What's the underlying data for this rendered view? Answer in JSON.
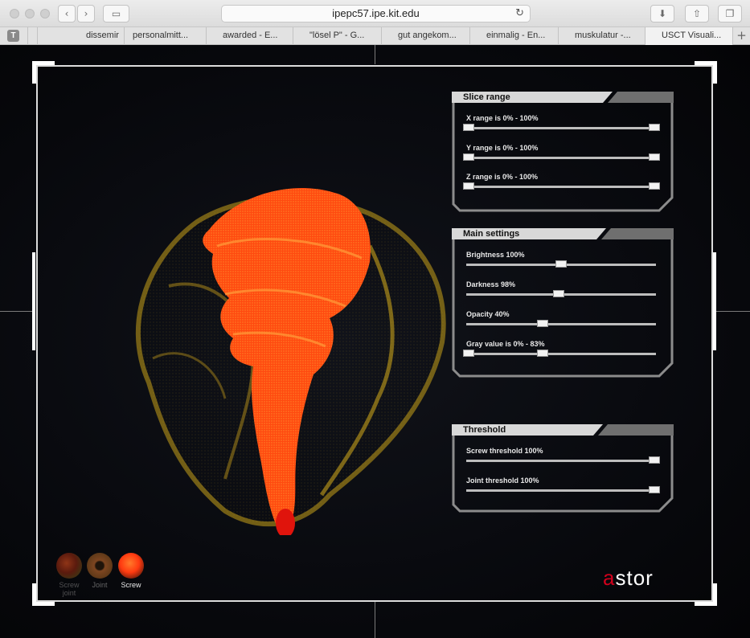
{
  "browser": {
    "url": "ipepc57.ipe.kit.edu",
    "tabs": [
      {
        "label": "dissemir"
      },
      {
        "label": "personalmitt..."
      },
      {
        "label": "awarded - E..."
      },
      {
        "label": "\"lösel P\" - G..."
      },
      {
        "label": "gut angekom..."
      },
      {
        "label": "einmalig - En..."
      },
      {
        "label": "muskulatur -..."
      },
      {
        "label": "USCT Visuali..."
      }
    ],
    "pinned_tab_letter": "T"
  },
  "panels": {
    "slice_range": {
      "title": "Slice range",
      "sliders": [
        {
          "label": "X range is 0% - 100%",
          "low": 0,
          "high": 100
        },
        {
          "label": "Y range is 0% - 100%",
          "low": 0,
          "high": 100
        },
        {
          "label": "Z range is 0% - 100%",
          "low": 0,
          "high": 100
        }
      ]
    },
    "main_settings": {
      "title": "Main settings",
      "sliders": [
        {
          "label": "Brightness 100%",
          "value": 50
        },
        {
          "label": "Darkness 98%",
          "value": 49
        },
        {
          "label": "Opacity 40%",
          "value": 40
        },
        {
          "label": "Gray value is 0% - 83%",
          "low": 0,
          "high": 40
        }
      ]
    },
    "threshold": {
      "title": "Threshold",
      "sliders": [
        {
          "label": "Screw threshold 100%",
          "value": 100
        },
        {
          "label": "Joint threshold 100%",
          "value": 100
        }
      ]
    }
  },
  "modes": [
    {
      "label": "Screw joint",
      "icon": "screw-joint-icon",
      "active": false
    },
    {
      "label": "Joint",
      "icon": "joint-icon",
      "active": false
    },
    {
      "label": "Screw",
      "icon": "screw-icon",
      "active": true
    }
  ],
  "logo": {
    "prefix": "a",
    "rest": "stor"
  },
  "colors": {
    "accent_red": "#d1001c",
    "screw_orange": "#ff4a10",
    "bone_yellow": "#d8b21a"
  }
}
